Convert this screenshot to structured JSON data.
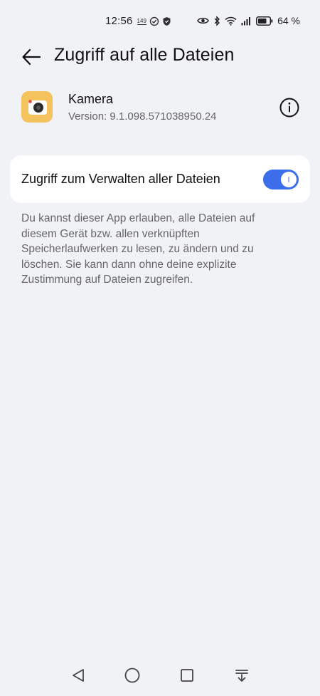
{
  "status_bar": {
    "time": "12:56",
    "badge": "149",
    "battery_percent": "64 %",
    "icons": [
      "check-circle-icon",
      "shield-icon",
      "eye-icon",
      "bluetooth-icon",
      "wifi-icon",
      "signal-icon",
      "battery-icon"
    ]
  },
  "header": {
    "title": "Zugriff auf alle Dateien",
    "back_icon": "arrow-left-icon"
  },
  "app": {
    "name": "Kamera",
    "version": "Version: 9.1.098.571038950.24",
    "icon": "camera-app-icon",
    "icon_color": "#f4c35e"
  },
  "setting": {
    "label": "Zugriff zum Verwalten aller Dateien",
    "enabled": true,
    "accent_color": "#3b6ee8"
  },
  "description": "Du kannst dieser App erlauben, alle Dateien auf diesem Gerät bzw. allen verknüpften Speicherlaufwerken zu lesen, zu ändern und zu löschen. Sie kann dann ohne deine explizite Zustimmung auf Dateien zugreifen.",
  "nav_bar": {
    "icons": [
      "back-triangle-icon",
      "home-circle-icon",
      "recents-square-icon",
      "notification-pull-icon"
    ]
  }
}
